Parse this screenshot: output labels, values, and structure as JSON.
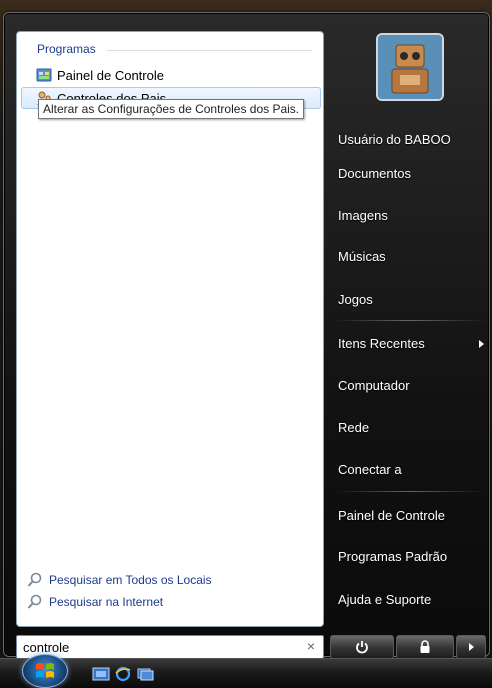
{
  "left_pane": {
    "section_title": "Programas",
    "programs": [
      {
        "label": "Painel de Controle",
        "icon": "control-panel-icon"
      },
      {
        "label": "Controles dos Pais",
        "icon": "parental-controls-icon"
      }
    ],
    "tooltip": "Alterar as Configurações de Controles dos Pais.",
    "search_links": [
      {
        "label": "Pesquisar em Todos os Locais",
        "icon": "search-icon"
      },
      {
        "label": "Pesquisar na Internet",
        "icon": "search-icon"
      }
    ]
  },
  "search": {
    "value": "controle",
    "clear_glyph": "×"
  },
  "right_pane": {
    "user": "Usuário do BABOO",
    "items": [
      "Documentos",
      "Imagens",
      "Músicas",
      "Jogos",
      "Itens Recentes",
      "Computador",
      "Rede",
      "Conectar a",
      "Painel de Controle",
      "Programas Padrão",
      "Ajuda e Suporte"
    ]
  },
  "colors": {
    "accent_link": "#1e3c8c",
    "selected_bg": "#dcebfc",
    "menu_bg": "#121212"
  }
}
